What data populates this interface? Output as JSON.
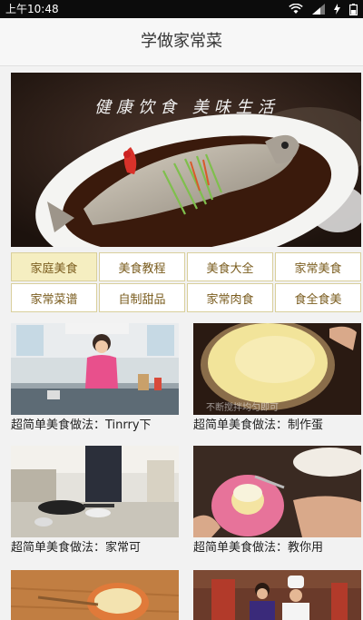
{
  "status_bar": {
    "time": "上午10:48"
  },
  "app_bar": {
    "title": "学做家常菜"
  },
  "banner": {
    "slogan": "健康饮食 美味生活"
  },
  "categories": [
    {
      "label": "家庭美食",
      "active": true
    },
    {
      "label": "美食教程",
      "active": false
    },
    {
      "label": "美食大全",
      "active": false
    },
    {
      "label": "家常美食",
      "active": false
    },
    {
      "label": "家常菜谱",
      "active": false
    },
    {
      "label": "自制甜品",
      "active": false
    },
    {
      "label": "家常肉食",
      "active": false
    },
    {
      "label": "食全食美",
      "active": false
    }
  ],
  "videos": [
    {
      "caption": "超简单美食做法：Tinrry下",
      "overlay": ""
    },
    {
      "caption": "超简单美食做法：制作蛋",
      "overlay": "不断搅拌均匀即可"
    },
    {
      "caption": "超简单美食做法：家常可",
      "overlay": ""
    },
    {
      "caption": "超简单美食做法：教你用",
      "overlay": ""
    },
    {
      "caption": "",
      "overlay": ""
    },
    {
      "caption": "",
      "overlay": ""
    }
  ],
  "colors": {
    "category_border": "#d9cf9c",
    "category_text": "#7a5c1e",
    "category_active_bg": "#f5eec1",
    "status_bar_bg": "#0c0c0c"
  }
}
